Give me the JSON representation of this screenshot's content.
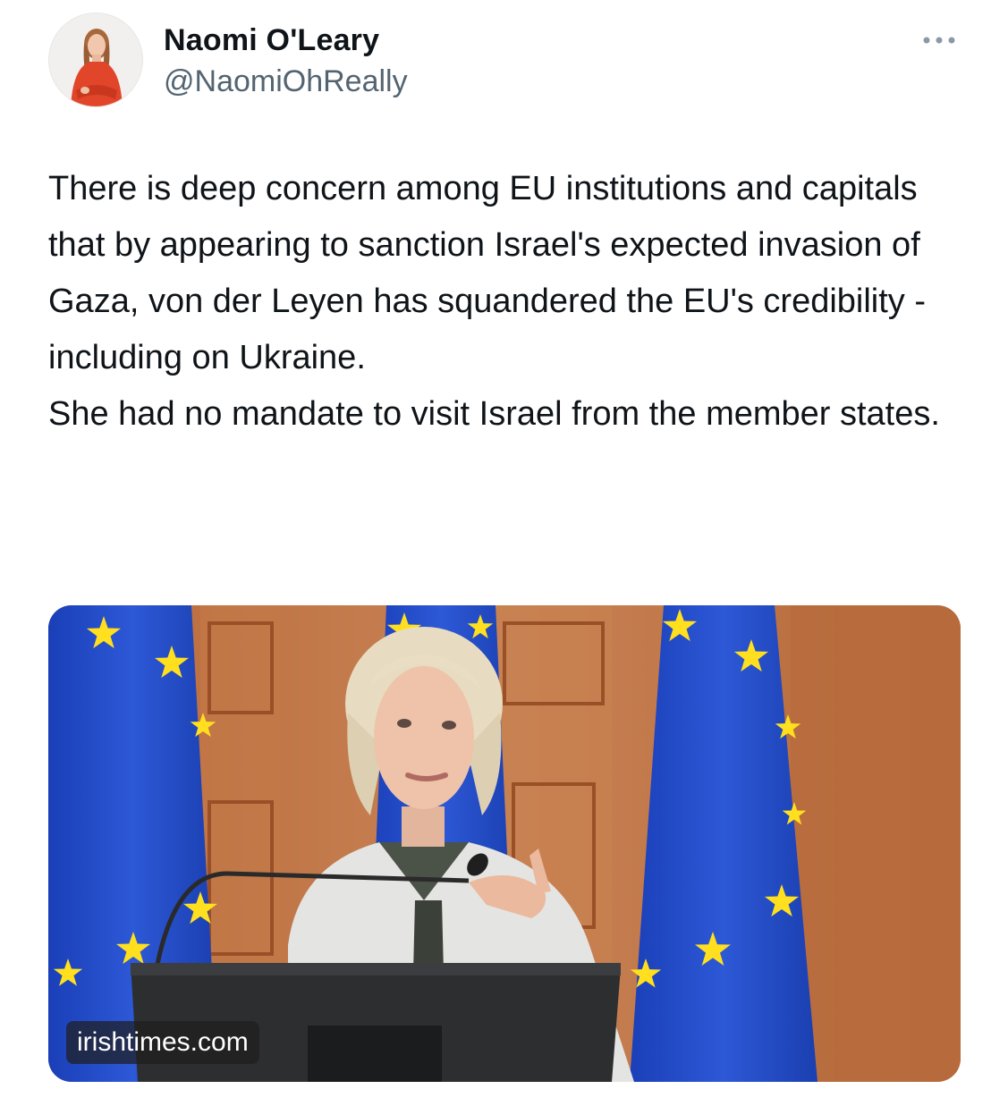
{
  "tweet": {
    "author_name": "Naomi O'Leary",
    "author_handle": "@NaomiOhReally",
    "more_icon": "more-horizontal-icon",
    "paragraphs": [
      "There is deep concern among EU institutions and capitals that by appearing to sanction Israel's expected invasion of Gaza, von der Leyen has squandered the EU's credibility - including on Ukraine.",
      "She had no mandate to visit Israel from the member states."
    ]
  },
  "media": {
    "source_domain": "irishtimes.com"
  },
  "colors": {
    "text_primary": "#0f1419",
    "text_secondary": "#536471",
    "eu_blue": "#1d46c8",
    "eu_star": "#ffdf1e"
  }
}
